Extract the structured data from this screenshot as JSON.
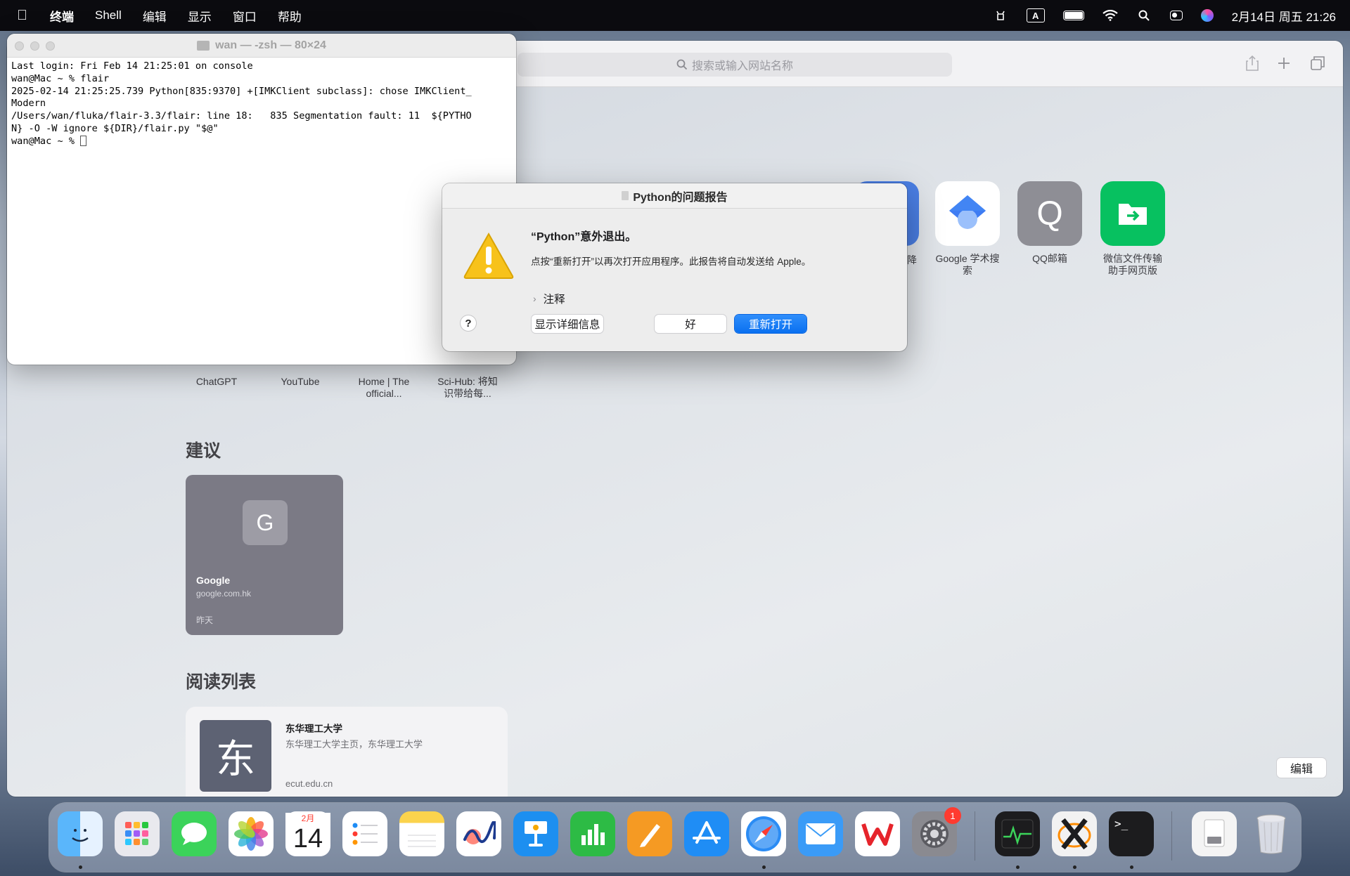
{
  "menubar": {
    "app_name": "终端",
    "items": [
      "Shell",
      "编辑",
      "显示",
      "窗口",
      "帮助"
    ],
    "input_indicator": "A",
    "clock": "2月14日 周五 21:26"
  },
  "safari": {
    "search_placeholder": "搜索或输入网站名称",
    "favorites": [
      {
        "label": "Google 学术搜索",
        "icon": "google-scholar-icon",
        "color": "#1a73e8"
      },
      {
        "label": "QQ邮箱",
        "icon": "qq-mail-icon",
        "glyph": "Q",
        "color": "#8e8e95"
      },
      {
        "label": "微信文件传输助手网页版",
        "icon": "wechat-file-transfer-icon",
        "color": "#07c160"
      }
    ],
    "partial_favorite_fragment": "降",
    "favorites_row2": [
      {
        "label": "ChatGPT"
      },
      {
        "label": "YouTube"
      },
      {
        "label": "Home | The official..."
      },
      {
        "label": "Sci-Hub: 将知识带给每..."
      }
    ],
    "suggestions_heading": "建议",
    "suggestion_card": {
      "letter": "G",
      "title": "Google",
      "url": "google.com.hk",
      "time": "昨天"
    },
    "reading_list_heading": "阅读列表",
    "reading_item": {
      "thumb": "东",
      "title": "东华理工大学",
      "desc": "东华理工大学主页，东华理工大学",
      "url": "ecut.edu.cn"
    },
    "edit_button": "编辑"
  },
  "terminal": {
    "title": "wan — -zsh — 80×24",
    "lines": [
      "Last login: Fri Feb 14 21:25:01 on console",
      "wan@Mac ~ % flair",
      "2025-02-14 21:25:25.739 Python[835:9370] +[IMKClient subclass]: chose IMKClient_",
      "Modern",
      "/Users/wan/fluka/flair-3.3/flair: line 18:   835 Segmentation fault: 11  ${PYTHO",
      "N} -O -W ignore ${DIR}/flair.py \"$@\"",
      "wan@Mac ~ % "
    ]
  },
  "dialog": {
    "title": "Python的问题报告",
    "heading": "“Python”意外退出。",
    "body": "点按“重新打开”以再次打开应用程序。此报告将自动发送给 Apple。",
    "notes_label": "注释",
    "help_label": "?",
    "details_button": "显示详细信息",
    "ok_button": "好",
    "reopen_button": "重新打开"
  },
  "dock": {
    "apps": [
      {
        "name": "finder-icon",
        "color": "#3d9bf5"
      },
      {
        "name": "launchpad-icon",
        "color": "#e9e9ee"
      },
      {
        "name": "messages-icon",
        "color": "#3bd35a"
      },
      {
        "name": "photos-icon",
        "color": "#ffffff"
      },
      {
        "name": "calendar-icon",
        "color": "#ffffff"
      },
      {
        "name": "reminders-icon",
        "color": "#ffffff"
      },
      {
        "name": "notes-icon",
        "color": "#fbd34c"
      },
      {
        "name": "freeform-icon",
        "color": "#ffffff"
      },
      {
        "name": "keynote-icon",
        "color": "#1d8ff0"
      },
      {
        "name": "numbers-icon",
        "color": "#2dbb45"
      },
      {
        "name": "pages-icon",
        "color": "#f59a23"
      },
      {
        "name": "app-store-icon",
        "color": "#1f8df5"
      },
      {
        "name": "safari-icon",
        "color": "#2b8cf4"
      },
      {
        "name": "mail-icon",
        "color": "#3a9bf7"
      },
      {
        "name": "wps-icon",
        "color": "#ffffff"
      },
      {
        "name": "system-settings-icon",
        "color": "#8a8a90"
      }
    ],
    "calendar_month": "2月",
    "calendar_day": "14",
    "settings_badge": "1",
    "recent_apps": [
      {
        "name": "activity-monitor-icon",
        "color": "#1c1c1e"
      },
      {
        "name": "xquartz-icon",
        "color": "#ffffff"
      },
      {
        "name": "terminal-icon",
        "color": "#1c1c1e"
      }
    ],
    "terminal_glyph": ">_"
  }
}
